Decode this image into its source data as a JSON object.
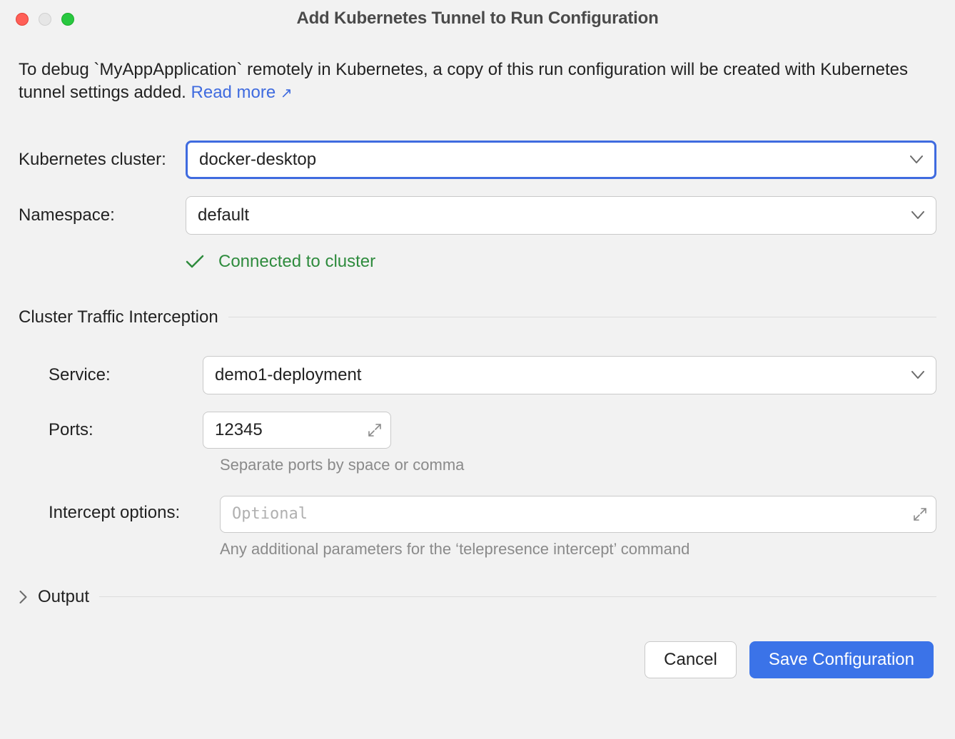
{
  "window": {
    "title": "Add Kubernetes Tunnel to Run Configuration"
  },
  "intro": {
    "text_prefix": "To debug `MyAppApplication` remotely in Kubernetes, a copy of this run configuration will be created with Kubernetes tunnel settings added. ",
    "link_label": "Read more"
  },
  "form": {
    "cluster_label": "Kubernetes cluster:",
    "cluster_value": "docker-desktop",
    "namespace_label": "Namespace:",
    "namespace_value": "default",
    "status_text": "Connected to cluster"
  },
  "section_traffic": {
    "title": "Cluster Traffic Interception",
    "service_label": "Service:",
    "service_value": "demo1-deployment",
    "ports_label": "Ports:",
    "ports_value": "12345",
    "ports_hint": "Separate ports by space or comma",
    "intercept_label": "Intercept options:",
    "intercept_placeholder": "Optional",
    "intercept_hint": "Any additional parameters for the ‘telepresence intercept’ command"
  },
  "section_output": {
    "title": "Output"
  },
  "footer": {
    "cancel": "Cancel",
    "save": "Save Configuration"
  }
}
